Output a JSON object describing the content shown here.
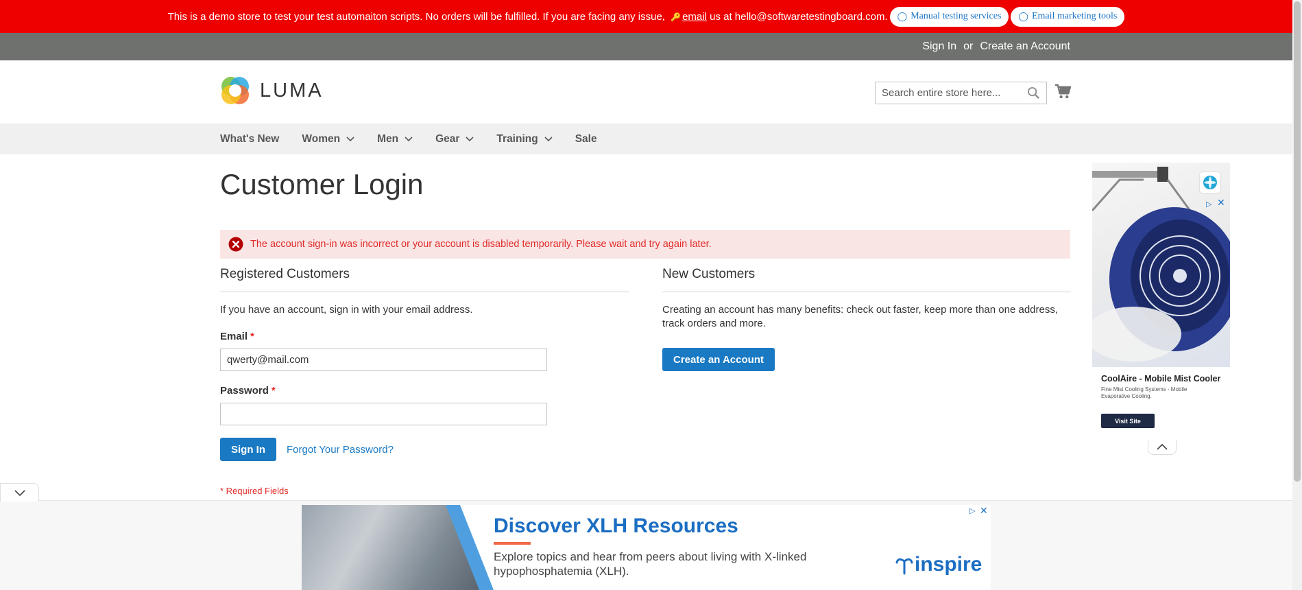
{
  "banner": {
    "message_before": "This is a demo store to test your test automaiton scripts. No orders will be fulfilled. If you are facing any issue,",
    "email_link": "email",
    "message_after": "us at hello@softwaretestingboard.com.",
    "pills": [
      {
        "label": "Manual testing services"
      },
      {
        "label": "Email marketing tools"
      }
    ],
    "color": "#ef0000"
  },
  "account": {
    "sign_in": "Sign In",
    "or": "or",
    "create_account": "Create an Account"
  },
  "header": {
    "logo_text": "LUMA",
    "search_placeholder": "Search entire store here..."
  },
  "nav": {
    "items": [
      {
        "label": "What's New",
        "has_submenu": false
      },
      {
        "label": "Women",
        "has_submenu": true
      },
      {
        "label": "Men",
        "has_submenu": true
      },
      {
        "label": "Gear",
        "has_submenu": true
      },
      {
        "label": "Training",
        "has_submenu": true
      },
      {
        "label": "Sale",
        "has_submenu": false
      }
    ]
  },
  "page": {
    "title": "Customer Login",
    "error": "The account sign-in was incorrect or your account is disabled temporarily. Please wait and try again later.",
    "required_note": "* Required Fields"
  },
  "registered": {
    "heading": "Registered Customers",
    "intro": "If you have an account, sign in with your email address.",
    "email_label": "Email",
    "email_value": "qwerty@mail.com",
    "password_label": "Password",
    "password_value": "",
    "required_mark": "*",
    "sign_in_button": "Sign In",
    "forgot_link": "Forgot Your Password?"
  },
  "new_customers": {
    "heading": "New Customers",
    "intro": "Creating an account has many benefits: check out faster, keep more than one address, track orders and more.",
    "create_button": "Create an Account"
  },
  "side_ad": {
    "title": "CoolAire - Mobile Mist Cooler",
    "description": "Fine Mist Cooling Systems - Mobile Evaporative Cooling.",
    "visit_button": "Visit Site"
  },
  "bottom_ad": {
    "headline": "Discover XLH Resources",
    "body": "Explore topics and hear from peers about living with X-linked hypophosphatemia (XLH).",
    "brand": "inspire"
  },
  "colors": {
    "primary_button": "#1979c3",
    "error_text": "#e02b27",
    "error_bg": "#fae5e5",
    "account_bar": "#6e716e",
    "nav_bg": "#f0f0f0"
  }
}
